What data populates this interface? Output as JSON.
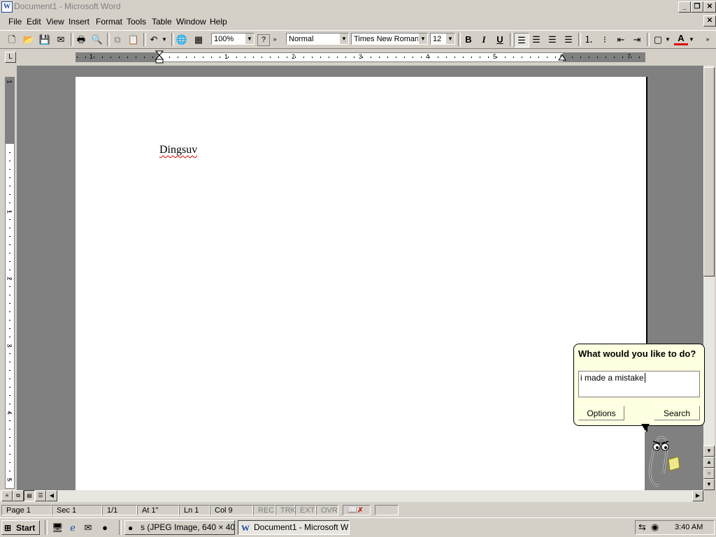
{
  "window": {
    "title": "Document1 - Microsoft Word",
    "app_icon": "W"
  },
  "menu": {
    "items": [
      {
        "label": "File"
      },
      {
        "label": "Edit"
      },
      {
        "label": "View"
      },
      {
        "label": "Insert"
      },
      {
        "label": "Format"
      },
      {
        "label": "Tools"
      },
      {
        "label": "Table"
      },
      {
        "label": "Window"
      },
      {
        "label": "Help"
      }
    ]
  },
  "toolbar": {
    "zoom": "100%",
    "style": "Normal",
    "font": "Times New Roman",
    "font_size": "12",
    "bold": "B",
    "italic": "I",
    "underline": "U",
    "help_q": "?",
    "font_color_letter": "A"
  },
  "ruler": {
    "h_labels": [
      "1",
      "1",
      "2",
      "3",
      "4",
      "5",
      "6",
      "7"
    ],
    "v_labels": [
      "1",
      "1",
      "2",
      "3",
      "4",
      "5"
    ]
  },
  "document": {
    "text": "Dingsuv"
  },
  "assistant": {
    "question": "What would you like to do?",
    "input_value": "i made a mistake",
    "options_label": "Options",
    "search_label": "Search"
  },
  "statusbar": {
    "page": "Page  1",
    "sec": "Sec  1",
    "pages": "1/1",
    "at": "At  1\"",
    "ln": "Ln  1",
    "col": "Col  9",
    "rec": "REC",
    "trk": "TRK",
    "ext": "EXT",
    "ovr": "OVR"
  },
  "taskbar": {
    "start_label": "Start",
    "tasks": [
      {
        "label": "s (JPEG Image, 640 × 40..."
      },
      {
        "label": "Document1 - Microsoft W..."
      }
    ],
    "clock": "3:40 AM"
  },
  "colors": {
    "chrome": "#d4d0c8",
    "workspace": "#808080",
    "balloon": "#ffffe1",
    "spell_underline": "#e00000",
    "font_color": "#e00000"
  }
}
